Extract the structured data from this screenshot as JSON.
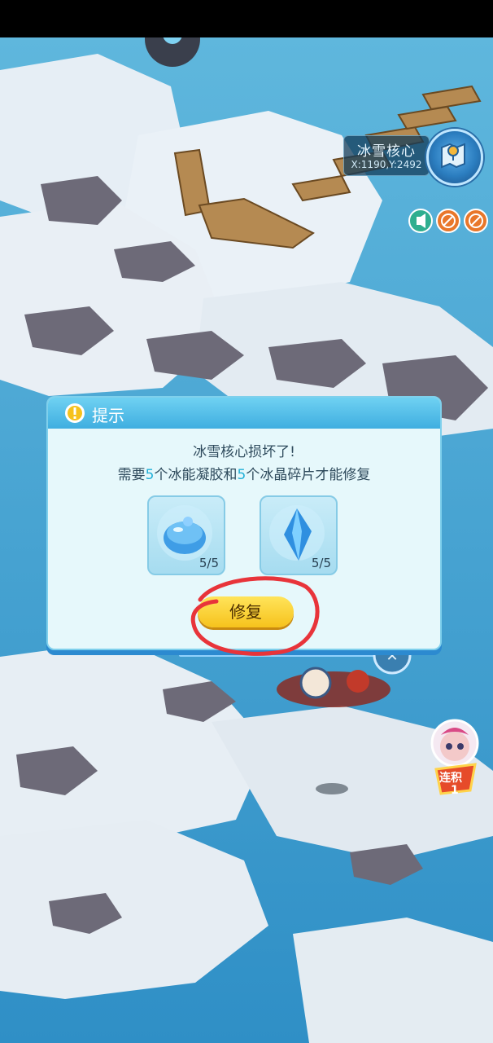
{
  "hud": {
    "location_name": "冰雪核心",
    "location_coords": "X:1190,Y:2492",
    "map_icon": "map-icon",
    "toggles": [
      {
        "icon": "voice-icon",
        "color": "#2fae8f"
      },
      {
        "icon": "no-sound-icon",
        "color": "#e9772a"
      },
      {
        "icon": "no-music-icon",
        "color": "#e9772a"
      }
    ]
  },
  "dialog": {
    "title": "提示",
    "title_icon": "exclamation-icon",
    "message_line1": "冰雪核心损坏了!",
    "message_line2_parts": {
      "a": "需要",
      "n1": "5",
      "b": "个冰能凝胶和",
      "n2": "5",
      "c": "个冰晶碎片才能修复"
    },
    "items": [
      {
        "icon": "ice-gel-icon",
        "count": "5/5"
      },
      {
        "icon": "ice-crystal-icon",
        "count": "5/5"
      }
    ],
    "repair_label": "修复"
  },
  "side": {
    "event_badge_text": "连积",
    "event_badge_number": "1"
  },
  "colors": {
    "dialog_bg": "#e6f8fb",
    "header": "#3faee0",
    "button": "#f6c21c",
    "annotation_circle": "#e8343a"
  }
}
